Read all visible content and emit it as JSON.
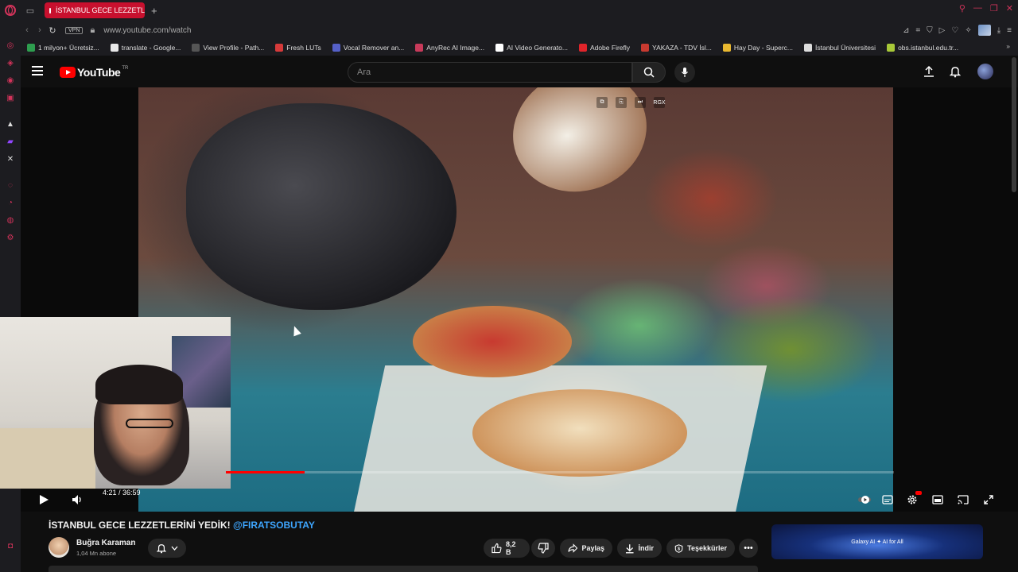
{
  "browser": {
    "tab": {
      "title": "İSTANBUL GECE LEZZETL"
    },
    "address": {
      "vpn_label": "VPN",
      "url": "www.youtube.com/watch"
    },
    "bookmarks": [
      {
        "label": "1 milyon+ Ücretsiz...",
        "color": "#2e9e4f"
      },
      {
        "label": "translate - Google...",
        "color": "#e8e8e8"
      },
      {
        "label": "View Profile - Path...",
        "color": "#555555"
      },
      {
        "label": "Fresh LUTs",
        "color": "#d63a3a"
      },
      {
        "label": "Vocal Remover an...",
        "color": "#5560c8"
      },
      {
        "label": "AnyRec AI Image...",
        "color": "#c83a5a"
      },
      {
        "label": "AI Video Generato...",
        "color": "#ffffff"
      },
      {
        "label": "Adobe Firefly",
        "color": "#e0242a"
      },
      {
        "label": "YAKAZA - TDV İsl...",
        "color": "#c83a30"
      },
      {
        "label": "Hay Day - Superc...",
        "color": "#e8b830"
      },
      {
        "label": "İstanbul Üniversitesi",
        "color": "#dddddd"
      },
      {
        "label": "obs.istanbul.edu.tr...",
        "color": "#a8c838"
      }
    ],
    "accent_color": "#d2335a"
  },
  "youtube": {
    "logo_text": "YouTube",
    "logo_region": "TR",
    "search": {
      "placeholder": "Ara"
    },
    "player": {
      "time": "4:21 / 36:59",
      "progress_fraction": 0.118
    },
    "video": {
      "title": "İSTANBUL GECE LEZZETLERİNİ YEDİK! ",
      "mention": "@FIRATSOBUTAY"
    },
    "channel": {
      "name": "Buğra Karaman",
      "subscribers": "1,04 Mn abone"
    },
    "actions": {
      "likes": "8,2 B",
      "share": "Paylaş",
      "download": "İndir",
      "thanks": "Teşekkürler"
    },
    "ad": {
      "text": "Galaxy AI  ✦  AI  for All"
    }
  }
}
